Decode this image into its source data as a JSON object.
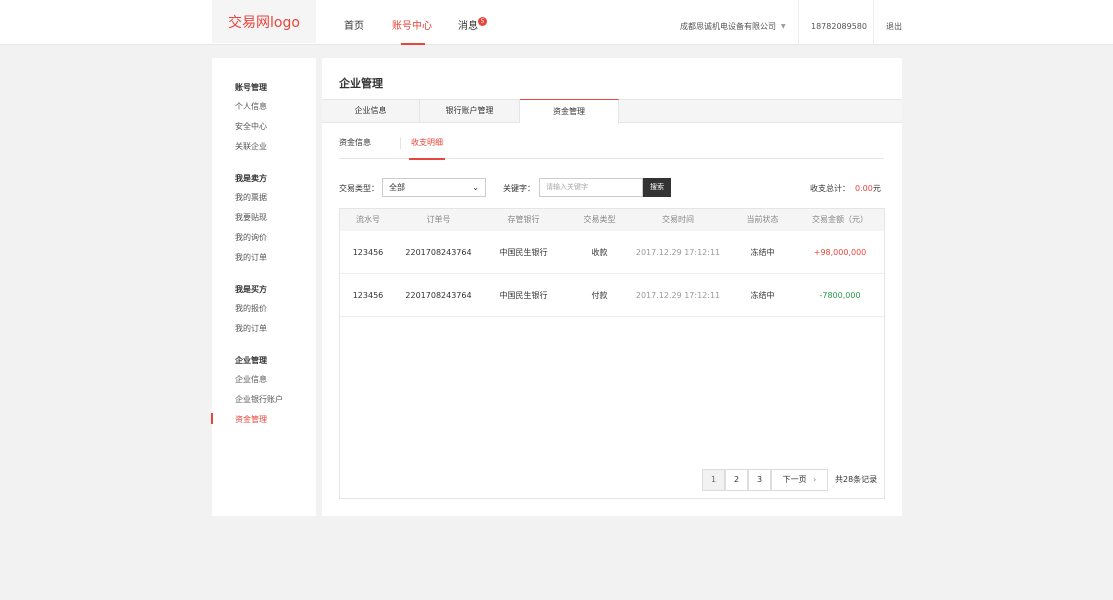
{
  "header": {
    "logo": "交易网logo",
    "nav": {
      "home": "首页",
      "account": "账号中心",
      "messages": "消息",
      "message_count": "5"
    },
    "company": "成都思诚机电设备有限公司",
    "phone": "18782089580",
    "logout": "退出"
  },
  "sidebar": {
    "sections": [
      {
        "title": "账号管理",
        "items": [
          "个人信息",
          "安全中心",
          "关联企业"
        ]
      },
      {
        "title": "我是卖方",
        "items": [
          "我的票据",
          "我要贴现",
          "我的询价",
          "我的订单"
        ]
      },
      {
        "title": "我是买方",
        "items": [
          "我的报价",
          "我的订单"
        ]
      },
      {
        "title": "企业管理",
        "items": [
          "企业信息",
          "企业银行账户",
          "资金管理"
        ]
      }
    ],
    "active_item": "资金管理"
  },
  "main": {
    "title": "企业管理",
    "tabs": [
      "企业信息",
      "银行账户管理",
      "资金管理"
    ],
    "active_tab": "资金管理",
    "subtabs": [
      "资金信息",
      "收支明细"
    ],
    "active_subtab": "收支明细",
    "filters": {
      "type_label": "交易类型：",
      "type_value": "全部",
      "keyword_label": "关键字：",
      "keyword_placeholder": "请输入关键字",
      "search_label": "搜索"
    },
    "total": {
      "label": "收支总计：",
      "amount": "0.00",
      "unit": "元"
    },
    "table": {
      "headers": [
        "流水号",
        "订单号",
        "存管银行",
        "交易类型",
        "交易时间",
        "当前状态",
        "交易金额（元）"
      ],
      "rows": [
        [
          "123456",
          "2201708243764",
          "中国民生银行",
          "收款",
          "2017.12.29 17:12:11",
          "冻结中",
          "+98,000,000"
        ],
        [
          "123456",
          "2201708243764",
          "中国民生银行",
          "付款",
          "2017.12.29 17:12:11",
          "冻结中",
          "-7800,000"
        ]
      ]
    },
    "pagination": {
      "pages": [
        "1",
        "2",
        "3"
      ],
      "current_page": "1",
      "next_label": "下一页",
      "total_label": "共28条记录"
    }
  },
  "colors": {
    "accent": "#e8453c",
    "positive_amount": "#e8453c",
    "negative_amount": "#2a9d4b"
  }
}
